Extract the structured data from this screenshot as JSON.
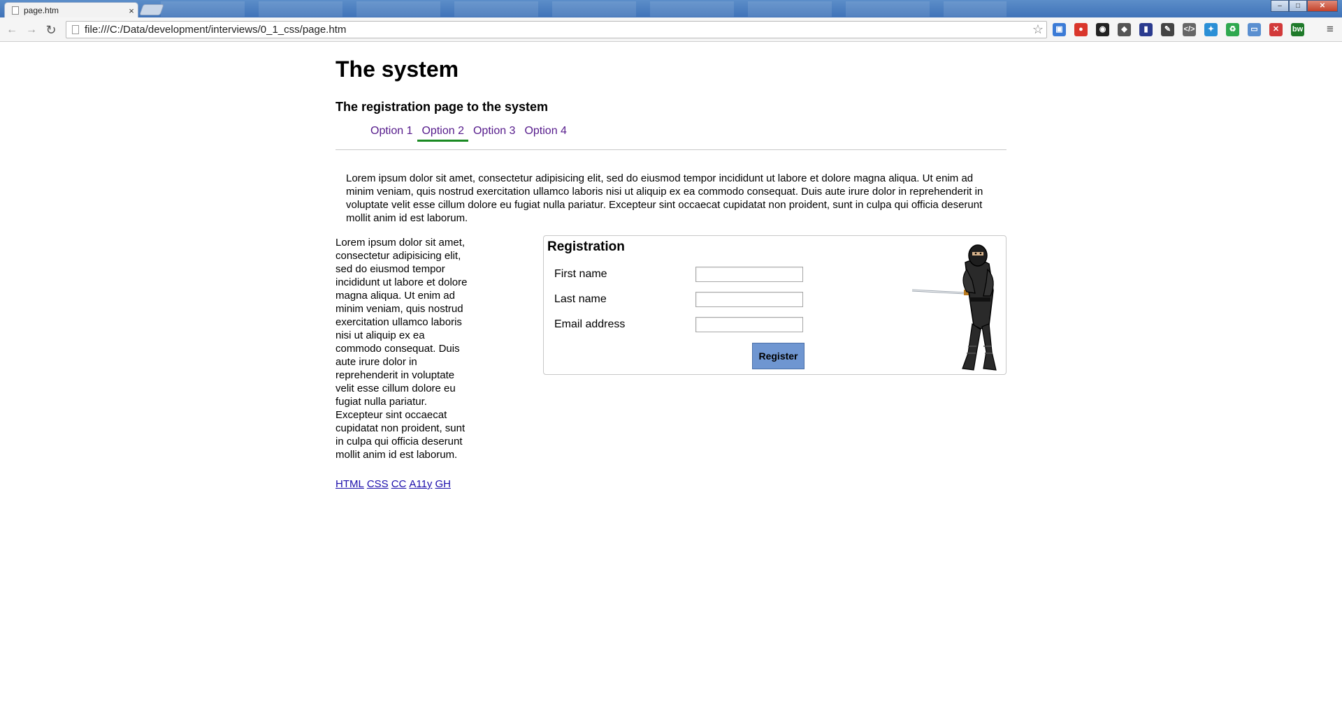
{
  "browser": {
    "tab_title": "page.htm",
    "tab_close": "×",
    "url": "file:///C:/Data/development/interviews/0_1_css/page.htm",
    "window_controls": {
      "minimize": "–",
      "maximize": "□",
      "close": "✕"
    },
    "nav": {
      "back": "←",
      "forward": "→",
      "reload": "↻",
      "star": "☆",
      "menu": "≡"
    },
    "extensions": [
      {
        "icon": "screen-capture-icon",
        "glyph": "▣",
        "color": "#3b7bd6"
      },
      {
        "icon": "red-extension-icon",
        "glyph": "●",
        "color": "#d9362b"
      },
      {
        "icon": "black-circle-extension-icon",
        "glyph": "◉",
        "color": "#222222"
      },
      {
        "icon": "diamond-extension-icon",
        "glyph": "◆",
        "color": "#555555"
      },
      {
        "icon": "book-extension-icon",
        "glyph": "▮",
        "color": "#2b3b8f"
      },
      {
        "icon": "evernote-extension-icon",
        "glyph": "✎",
        "color": "#444444"
      },
      {
        "icon": "code-extension-icon",
        "glyph": "</>",
        "color": "#666666"
      },
      {
        "icon": "blue-tool-extension-icon",
        "glyph": "✦",
        "color": "#2a8fd6"
      },
      {
        "icon": "green-extension-icon",
        "glyph": "♻",
        "color": "#2fa84f"
      },
      {
        "icon": "window-extension-icon",
        "glyph": "▭",
        "color": "#5a8fd0"
      },
      {
        "icon": "red-x-extension-icon",
        "glyph": "✕",
        "color": "#d23a3a"
      },
      {
        "icon": "bw-extension-icon",
        "glyph": "bw",
        "color": "#1f7a2a"
      }
    ]
  },
  "page": {
    "title": "The system",
    "subtitle": "The registration page to the system",
    "menu": [
      "Option 1",
      "Option 2",
      "Option 3",
      "Option 4"
    ],
    "active_menu_index": 1,
    "intro_text": "Lorem ipsum dolor sit amet, consectetur adipisicing elit, sed do eiusmod tempor incididunt ut labore et dolore magna aliqua. Ut enim ad minim veniam, quis nostrud exercitation ullamco laboris nisi ut aliquip ex ea commodo consequat. Duis aute irure dolor in reprehenderit in voluptate velit esse cillum dolore eu fugiat nulla pariatur. Excepteur sint occaecat cupidatat non proident, sunt in culpa qui officia deserunt mollit anim id est laborum.",
    "sidebar_text": "Lorem ipsum dolor sit amet, consectetur adipisicing elit, sed do eiusmod tempor incididunt ut labore et dolore magna aliqua. Ut enim ad minim veniam, quis nostrud exercitation ullamco laboris nisi ut aliquip ex ea commodo consequat. Duis aute irure dolor in reprehenderit in voluptate velit esse cillum dolore eu fugiat nulla pariatur. Excepteur sint occaecat cupidatat non proident, sunt in culpa qui officia deserunt mollit anim id est laborum.",
    "footer_links": [
      "HTML",
      "CSS",
      "CC",
      "A11y",
      "GH"
    ],
    "registration": {
      "heading": "Registration",
      "fields": [
        {
          "label": "First name",
          "value": ""
        },
        {
          "label": "Last name",
          "value": ""
        },
        {
          "label": "Email address",
          "value": ""
        }
      ],
      "submit_label": "Register",
      "accent_color": "#6f96d1"
    },
    "nav_active_color": "#1a8a22",
    "link_color": "#551a8b"
  }
}
